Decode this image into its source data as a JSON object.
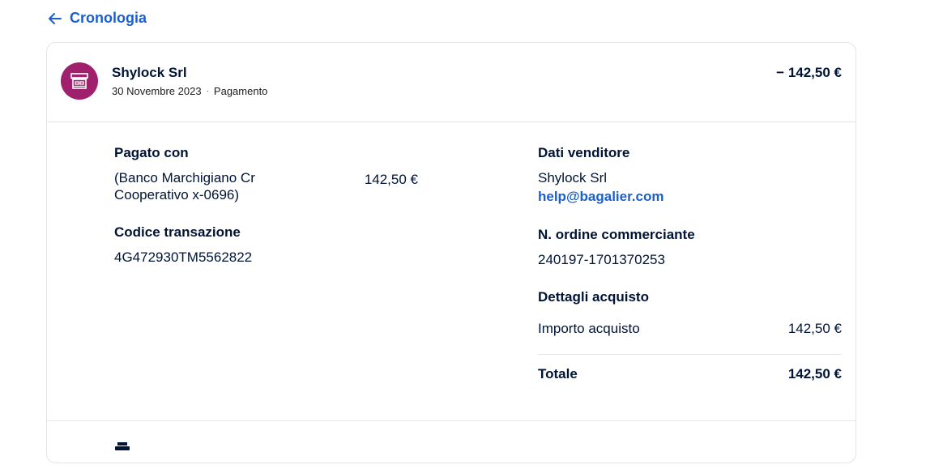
{
  "back": {
    "label": "Cronologia"
  },
  "header": {
    "merchant": "Shylock Srl",
    "date": "30 Novembre 2023",
    "separator": "·",
    "type": "Pagamento",
    "amount": "− 142,50 €"
  },
  "left": {
    "paid_with_title": "Pagato con",
    "bank_line1": "(Banco Marchigiano Cr",
    "bank_line2": "Cooperativo x-0696)",
    "paid_amount": "142,50 €",
    "transaction_title": "Codice transazione",
    "transaction_code": "4G472930TM5562822"
  },
  "right": {
    "seller_title": "Dati venditore",
    "seller_name": "Shylock Srl",
    "seller_email": "help@bagalier.com",
    "order_title": "N. ordine commerciante",
    "order_number": "240197-1701370253",
    "purchase_title": "Dettagli acquisto",
    "purchase_label": "Importo acquisto",
    "purchase_amount": "142,50 €",
    "total_label": "Totale",
    "total_amount": "142,50 €"
  },
  "colors": {
    "accent": "#1a5fd0",
    "avatar": "#a0206e"
  }
}
